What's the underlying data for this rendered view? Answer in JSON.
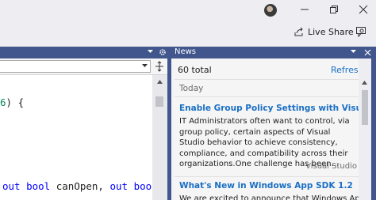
{
  "titlebar": {
    "live_share_label": "Live Share"
  },
  "editor": {
    "code_lines": [
      {
        "num": "6",
        "rest": ") {"
      },
      {
        "kw1": "out",
        "type1": "bool",
        "id1": "canOpen,",
        "kw2": "out",
        "type2": "bool"
      }
    ]
  },
  "news": {
    "tab_title": "News",
    "total": "60 total",
    "refresh_label": "Refresh",
    "group_label": "Today",
    "articles": [
      {
        "title": "Enable Group Policy Settings with Visual Studio...",
        "body": "IT Administrators often want to control, via group policy, certain aspects of Visual Studio behavior to achieve consistency, compliance, and compatibility across their organizations.One challenge has been...",
        "source": "Visual Studio"
      },
      {
        "title": "What's New in Windows App SDK 1.2",
        "body": "We are excited to announce that Windows App SDK"
      }
    ]
  },
  "colors": {
    "accent_blue": "#40568d",
    "link_blue": "#1a6fc4",
    "keyword_blue": "#0000ff"
  }
}
